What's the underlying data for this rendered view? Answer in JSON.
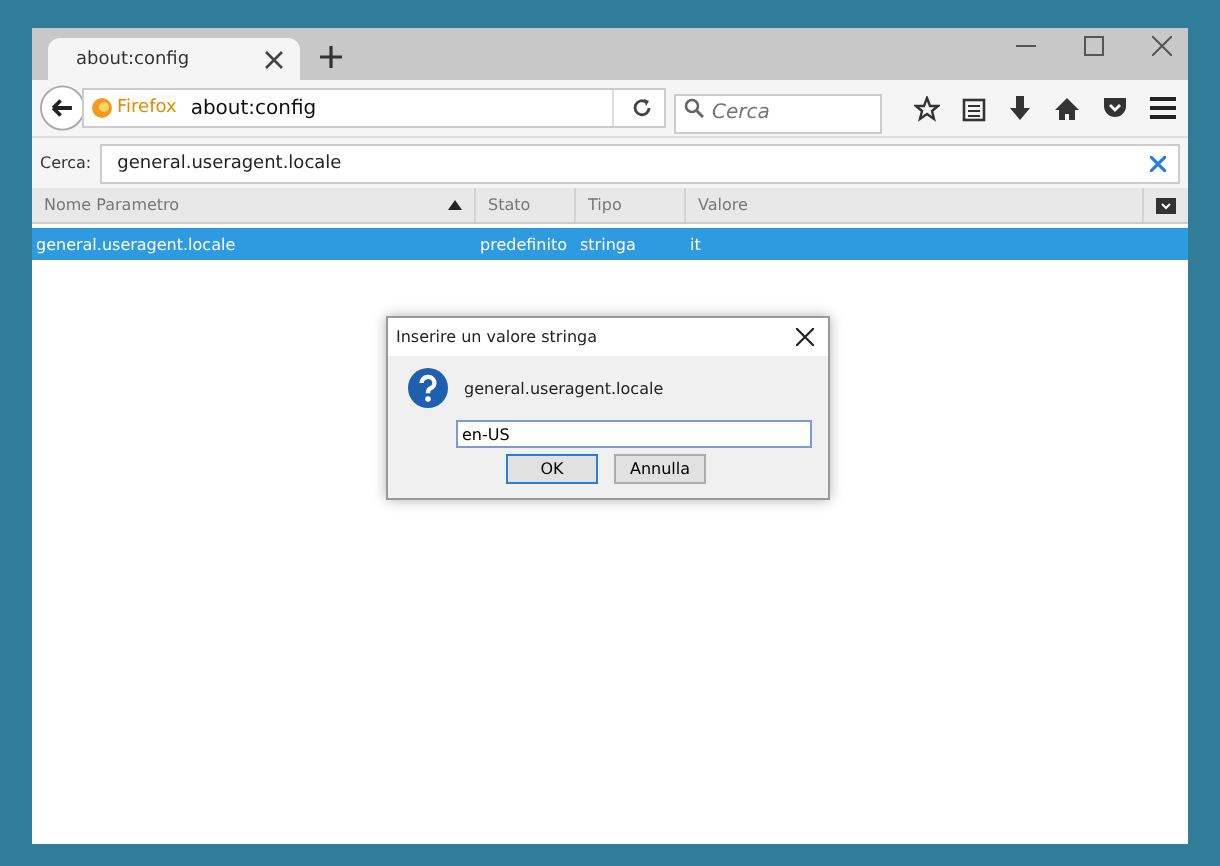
{
  "tab": {
    "title": "about:config",
    "selected": true
  },
  "url_bar": {
    "identity": "Firefox",
    "url": "about:config"
  },
  "search_box": {
    "placeholder": "Cerca"
  },
  "filter": {
    "label": "Cerca:",
    "value": "general.useragent.locale"
  },
  "table": {
    "columns": [
      {
        "label": "Nome Parametro",
        "sorted": true
      },
      {
        "label": "Stato",
        "sorted": false
      },
      {
        "label": "Tipo",
        "sorted": false
      },
      {
        "label": "Valore",
        "sorted": false
      }
    ],
    "rows": [
      {
        "cells": [
          "general.useragent.locale",
          "predefinito",
          "stringa",
          "it"
        ],
        "selected": true
      }
    ]
  },
  "dialog": {
    "title": "Inserire un valore stringa",
    "message": "general.useragent.locale",
    "value": "en-US",
    "buttons": [
      {
        "label": "OK",
        "default": true
      },
      {
        "label": "Annulla",
        "default": false
      }
    ]
  }
}
